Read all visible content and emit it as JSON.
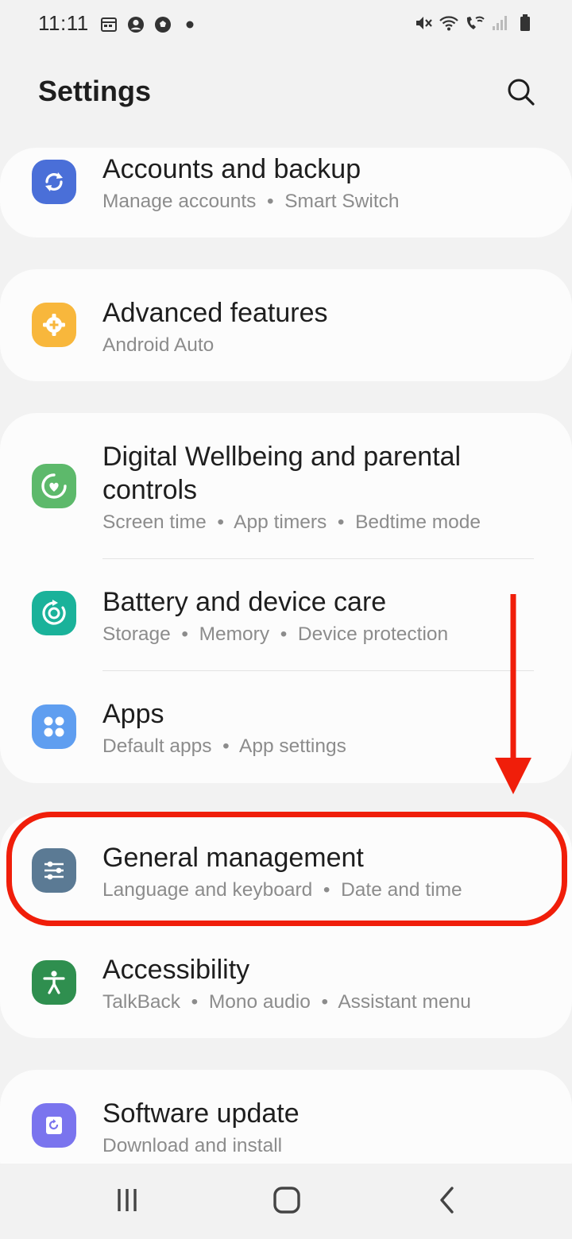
{
  "status_bar": {
    "time": "11:11",
    "left_icons": [
      "calendar-icon",
      "account-icon",
      "soccer-icon",
      "dot-icon"
    ],
    "right_icons": [
      "mute-icon",
      "wifi-icon",
      "wifi-calling-icon",
      "signal-icon",
      "battery-icon"
    ]
  },
  "header": {
    "title": "Settings",
    "search_icon": "search-icon"
  },
  "items": [
    {
      "title": "Accounts and backup",
      "subtitle": "Manage accounts  •  Smart Switch",
      "icon": "sync-icon",
      "icon_color": "#4a6fd8"
    },
    {
      "title": "Advanced features",
      "subtitle": "Android Auto",
      "icon": "gear-plus-icon",
      "icon_color": "#f8b73c"
    },
    {
      "title": "Digital Wellbeing and parental controls",
      "subtitle": "Screen time  •  App timers  •  Bedtime mode",
      "icon": "heart-ring-icon",
      "icon_color": "#5db96b"
    },
    {
      "title": "Battery and device care",
      "subtitle": "Storage  •  Memory  •  Device protection",
      "icon": "device-care-icon",
      "icon_color": "#1ab29a"
    },
    {
      "title": "Apps",
      "subtitle": "Default apps  •  App settings",
      "icon": "apps-grid-icon",
      "icon_color": "#5f9ef0"
    },
    {
      "title": "General management",
      "subtitle": "Language and keyboard  •  Date and time",
      "icon": "sliders-icon",
      "icon_color": "#5b7a94"
    },
    {
      "title": "Accessibility",
      "subtitle": "TalkBack  •  Mono audio  •  Assistant menu",
      "icon": "accessibility-icon",
      "icon_color": "#2f8f4f"
    },
    {
      "title": "Software update",
      "subtitle": "Download and install",
      "icon": "update-icon",
      "icon_color": "#7a74ee"
    }
  ],
  "annotation": {
    "arrow": "down-arrow-icon",
    "highlight_color": "#f01e0a",
    "highlighted_item": "General management"
  },
  "nav_bar": {
    "buttons": [
      "recent-apps-icon",
      "home-icon",
      "back-icon"
    ]
  }
}
